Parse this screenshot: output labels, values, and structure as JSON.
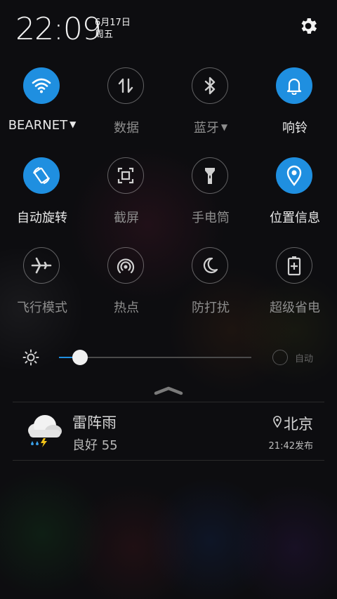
{
  "status": {
    "time": "22:09",
    "date": "6月17日",
    "weekday": "周五"
  },
  "tiles": [
    {
      "label": "BEARNET",
      "icon": "wifi-icon",
      "active": true,
      "dropdown": true
    },
    {
      "label": "数据",
      "icon": "mobile-data-icon",
      "active": false
    },
    {
      "label": "蓝牙",
      "icon": "bluetooth-icon",
      "active": false,
      "dropdown": true
    },
    {
      "label": "响铃",
      "icon": "bell-icon",
      "active": true
    },
    {
      "label": "自动旋转",
      "icon": "auto-rotate-icon",
      "active": true
    },
    {
      "label": "截屏",
      "icon": "screenshot-icon",
      "active": false
    },
    {
      "label": "手电筒",
      "icon": "flashlight-icon",
      "active": false
    },
    {
      "label": "位置信息",
      "icon": "location-icon",
      "active": true
    },
    {
      "label": "飞行模式",
      "icon": "airplane-icon",
      "active": false
    },
    {
      "label": "热点",
      "icon": "hotspot-icon",
      "active": false
    },
    {
      "label": "防打扰",
      "icon": "moon-icon",
      "active": false
    },
    {
      "label": "超级省电",
      "icon": "battery-saver-icon",
      "active": false
    }
  ],
  "brightness": {
    "level": 0.11,
    "auto_label": "自动"
  },
  "weather": {
    "condition": "雷阵雨",
    "air_quality": "良好 55",
    "city": "北京",
    "published": "21:42发布"
  },
  "colors": {
    "accent": "#1f8fe0"
  }
}
